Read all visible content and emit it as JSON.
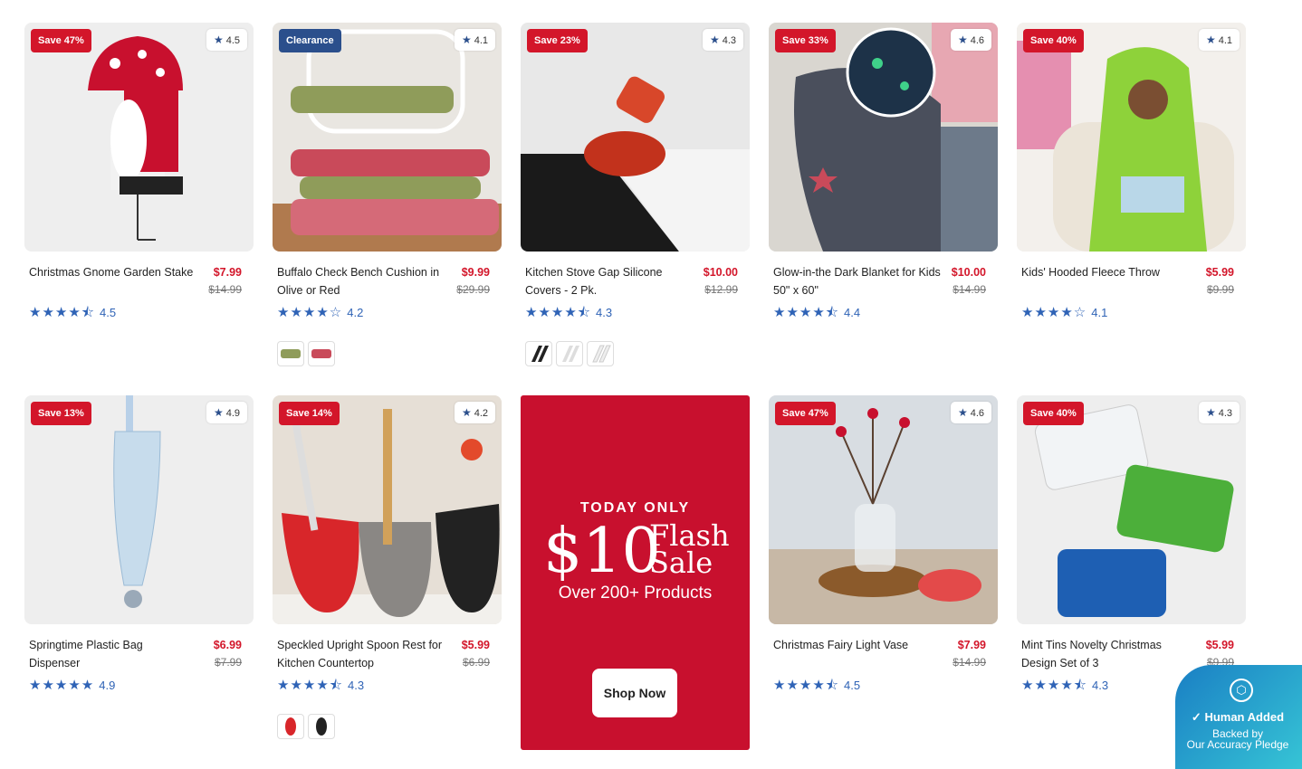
{
  "products": [
    {
      "title": "Christmas Gnome Garden Stake",
      "price": "$7.99",
      "was": "$14.99",
      "badge": "Save 47%",
      "rating": "4.5",
      "stars": "★★★★⯪"
    },
    {
      "title": "Buffalo Check Bench Cushion in Olive or Red",
      "price": "$9.99",
      "was": "$29.99",
      "badge": "Clearance",
      "rating": "4.1",
      "rating_text": "4.2",
      "stars": "★★★★☆"
    },
    {
      "title": "Kitchen Stove Gap Silicone Covers - 2 Pk.",
      "price": "$10.00",
      "was": "$12.99",
      "badge": "Save 23%",
      "rating": "4.3",
      "stars": "★★★★⯪"
    },
    {
      "title": "Glow-in-the Dark Blanket for Kids 50\" x 60\"",
      "price": "$10.00",
      "was": "$14.99",
      "badge": "Save 33%",
      "rating": "4.6",
      "rating_text": "4.4",
      "stars": "★★★★⯪"
    },
    {
      "title": "Kids' Hooded Fleece Throw",
      "price": "$5.99",
      "was": "$9.99",
      "badge": "Save 40%",
      "rating": "4.1",
      "stars": "★★★★☆"
    },
    {
      "title": "Springtime Plastic Bag Dispenser",
      "price": "$6.99",
      "was": "$7.99",
      "badge": "Save 13%",
      "rating": "4.9",
      "stars": "★★★★★"
    },
    {
      "title": "Speckled Upright Spoon Rest for Kitchen Countertop",
      "price": "$5.99",
      "was": "$6.99",
      "badge": "Save 14%",
      "rating": "4.2",
      "rating_text": "4.3",
      "stars": "★★★★⯪"
    },
    {
      "title": "Christmas Fairy Light Vase",
      "price": "$7.99",
      "was": "$14.99",
      "badge": "Save 47%",
      "rating": "4.6",
      "rating_text": "4.5",
      "stars": "★★★★⯪"
    },
    {
      "title": "Mint Tins Novelty Christmas Design Set of 3",
      "price": "$5.99",
      "was": "$9.99",
      "badge": "Save 40%",
      "rating": "4.3",
      "stars": "★★★★⯪"
    }
  ],
  "promo": {
    "today": "TODAY ONLY",
    "amount": "$10",
    "flash": "Flash",
    "sale": "Sale",
    "over": "Over 200+ Products",
    "button": "Shop Now"
  },
  "pledge": {
    "title": "Human Added",
    "line1": "Backed by",
    "line2": "Our Accuracy Pledge"
  },
  "colors": {
    "sale_red": "#d3162a",
    "star_blue": "#2f63b6",
    "promo_bg": "#c8102e",
    "clearance_blue": "#2b4f8c"
  }
}
